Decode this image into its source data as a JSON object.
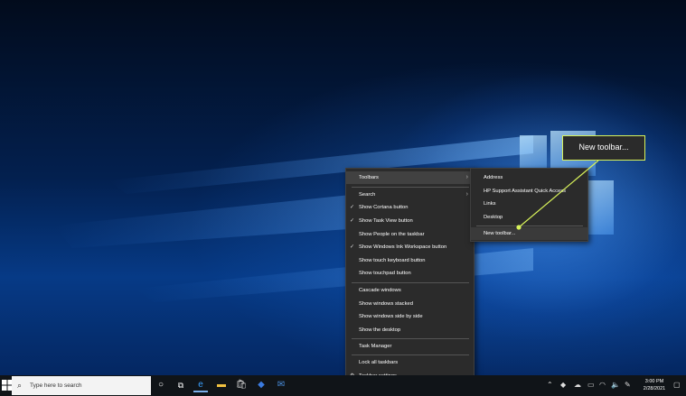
{
  "context_menu": {
    "items": [
      {
        "label": "Toolbars",
        "checked": false,
        "submenu": true
      },
      {
        "label": "Search",
        "checked": false,
        "submenu": true
      },
      {
        "label": "Show Cortana button",
        "checked": true
      },
      {
        "label": "Show Task View button",
        "checked": true
      },
      {
        "label": "Show People on the taskbar",
        "checked": false
      },
      {
        "label": "Show Windows Ink Workspace button",
        "checked": true
      },
      {
        "label": "Show touch keyboard button",
        "checked": false
      },
      {
        "label": "Show touchpad button",
        "checked": false
      },
      {
        "label": "Cascade windows"
      },
      {
        "label": "Show windows stacked"
      },
      {
        "label": "Show windows side by side"
      },
      {
        "label": "Show the desktop"
      },
      {
        "label": "Task Manager"
      },
      {
        "label": "Lock all taskbars"
      },
      {
        "label": "Taskbar settings"
      }
    ],
    "check_glyph": "✓",
    "arrow_glyph": "›"
  },
  "submenu": {
    "items": [
      "Address",
      "HP Support Assistant Quick Access",
      "Links",
      "Desktop",
      "New toolbar..."
    ]
  },
  "callout": {
    "text": "New toolbar...",
    "color": "#d8f25a"
  },
  "taskbar": {
    "search_placeholder": "Type here to search",
    "icons": [
      "windows-start-icon",
      "search-icon",
      "cortana-icon",
      "task-view-icon",
      "edge-icon",
      "file-explorer-icon",
      "store-icon",
      "dropbox-icon",
      "mail-icon"
    ],
    "clock_time": "3:00 PM",
    "clock_date": "2/28/2021"
  }
}
